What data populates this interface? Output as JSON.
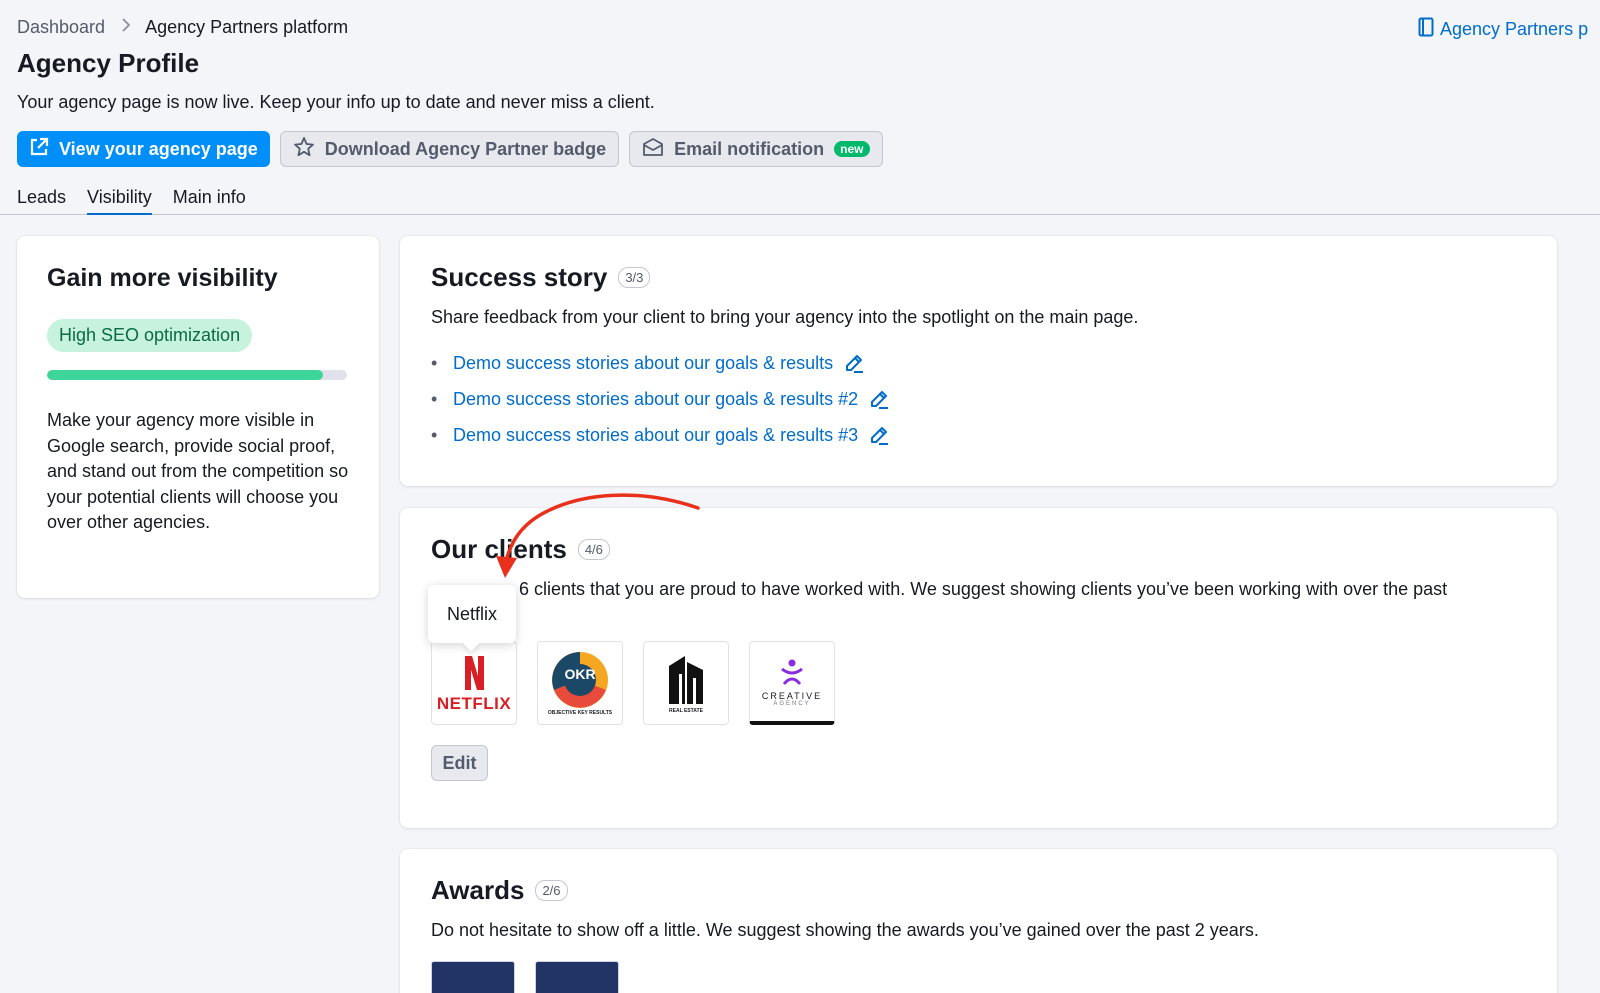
{
  "breadcrumb": {
    "home": "Dashboard",
    "current": "Agency Partners platform"
  },
  "top_right_link": "Agency Partners p",
  "page": {
    "title": "Agency Profile",
    "subtitle": "Your agency page is now live. Keep your info up to date and never miss a client."
  },
  "actions": {
    "view_page": "View your agency page",
    "download_badge": "Download Agency Partner badge",
    "email_notification": "Email notification",
    "new_badge": "new"
  },
  "tabs": [
    {
      "label": "Leads",
      "active": false
    },
    {
      "label": "Visibility",
      "active": true
    },
    {
      "label": "Main info",
      "active": false
    }
  ],
  "visibility_card": {
    "title": "Gain more visibility",
    "tag": "High SEO optimization",
    "progress": 0.92,
    "description": "Make your agency more visible in Google search, provide social proof, and stand out from the competition so your potential clients will choose you over other agencies."
  },
  "success_story": {
    "title": "Success story",
    "count": "3/3",
    "description": "Share feedback from your client to bring your agency into the spotlight on the main page.",
    "stories": [
      "Demo success stories about our goals & results",
      "Demo success stories about our goals & results #2",
      "Demo success stories about our goals & results #3"
    ]
  },
  "clients": {
    "title": "Our clients",
    "count": "4/6",
    "description": "6 clients that you are proud to have worked with. We suggest showing clients you’ve been working with over the past",
    "tooltip": "Netflix",
    "logos": [
      {
        "name": "NETFLIX",
        "mark": "N"
      },
      {
        "name": "OBJECTIVE KEY RESULTS",
        "mark": "OKR"
      },
      {
        "name": "REAL ESTATE",
        "mark": ""
      },
      {
        "name": "CREATIVE",
        "sub": "AGENCY"
      }
    ],
    "edit_label": "Edit"
  },
  "awards": {
    "title": "Awards",
    "count": "2/6",
    "description": "Do not hesitate to show off a little. We suggest showing the awards you’ve gained over the past 2 years."
  },
  "colors": {
    "primary": "#008ff8",
    "link": "#006dca",
    "seo_tag_bg": "#c7f2dd",
    "progress": "#3ed59a",
    "new_badge": "#00b96b",
    "annotation_arrow": "#e8301c"
  }
}
